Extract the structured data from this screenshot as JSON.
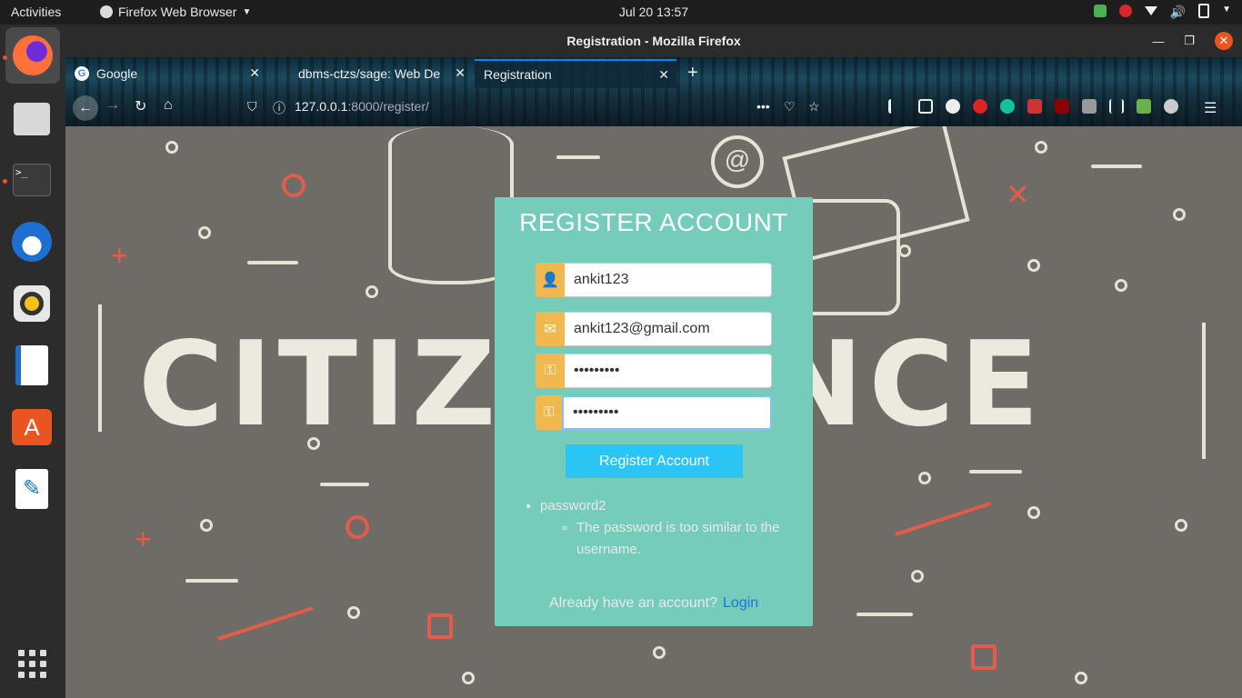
{
  "topbar": {
    "activities": "Activities",
    "app_name": "Firefox Web Browser",
    "clock": "Jul 20  13:57"
  },
  "window": {
    "title": "Registration - Mozilla Firefox"
  },
  "tabs": [
    {
      "label": "Google"
    },
    {
      "label": "dbms-ctzs/sage: Web De"
    },
    {
      "label": "Registration"
    }
  ],
  "url": {
    "host": "127.0.0.1",
    "rest": ":8000/register/"
  },
  "page": {
    "background_text": "CITIZE      IENCE"
  },
  "form": {
    "heading": "REGISTER ACCOUNT",
    "username": "ankit123",
    "email": "ankit123@gmail.com",
    "password1": "•••••••••",
    "password2": "•••••••••",
    "submit_label": "Register Account",
    "error_field": "password2",
    "error_message": "The password is too similar to the username.",
    "footer_text": "Already have an account?",
    "login_link": "Login"
  },
  "colors": {
    "card": "#75ccba",
    "icon_bg": "#f0b84f",
    "button": "#2bc4f5",
    "link": "#1a73e8"
  }
}
